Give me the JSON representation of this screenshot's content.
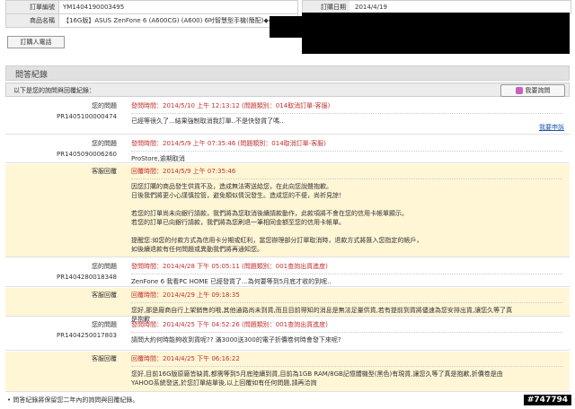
{
  "order": {
    "number_label": "訂單編號",
    "number": "YM1404190003495",
    "product_label": "商品名稱",
    "product": "【16G版】ASUS ZenFone 6 (A600CG) (A600) 6吋智慧型手機(簡配)◆4",
    "date_label": "訂購日期",
    "date": "2014/4/19",
    "phone_label": "訂購人電話"
  },
  "qa": {
    "title": "問答紀錄",
    "subtitle": "以下是您的詢問與回覆紀錄：",
    "ask_button": "我要詢問",
    "cancel_link": "我要申訴"
  },
  "messages": [
    {
      "role": "您的問題",
      "num": "PR1405100000474",
      "meta": "發問時間：2014/5/10 上午 12:13:12 (問題類別：014取消訂單-客服)",
      "body": [
        "已經等很久了...結果強制取消我訂單..不是快發貨了嗎.."
      ],
      "type": "user"
    },
    {
      "role": "您的問題",
      "num": "PR1405090006260",
      "meta": "發問時間：2014/5/9 上午 07:35:46 (問題類別：014取消訂單-客服)",
      "body": [
        "ProStore,逾期取消"
      ],
      "type": "user"
    },
    {
      "role": "客服回覆",
      "num": "",
      "meta": "回覆時間：2014/5/9 上午 07:35:46",
      "body": [
        "因您訂購的商品發生供貨不及，造成無法寄送給您，在此向您說聲抱歉。",
        "日後我們將更小心謹慎控管，避免類似情況發生。造成您的不便，尚祈見諒！",
        "",
        "若您的訂單尚未向銀行請款，我們將為您取消後續請款動作，此款項將不會在您的信用卡帳單顯示。",
        "若您的訂單已向銀行請款，我們將為您刷退一筆相同金額至您的信用卡帳單。",
        "",
        "提醒您:如您的付款方式為信用卡分期或紅利，當您辦理部分訂單取消時，退款方式將匯入您指定的帳戶，",
        "如後續退款有任何問題或異動我們將再通知您。"
      ],
      "type": "cs"
    },
    {
      "role": "您的問題",
      "num": "PR1404280018348",
      "meta": "發問時間：2014/4/28 下午 05:05:11 (問題類別：001查詢出貨進度)",
      "body": [
        "ZenFone 6 我看PC HOME 已經發貨了...為何要等到5月底才收的到呢.."
      ],
      "type": "user"
    },
    {
      "role": "客服回覆",
      "num": "",
      "meta": "回覆時間：2014/4/29 上午 09:18:35",
      "body": [
        "您好,那是廠商自行上架銷售的哦,其他通路尚未到貨,而且目前得知的消息是無法足量供貨,若有提前到貨將儘速為您安排出貨,讓您久等了真",
        "是抱歉"
      ],
      "type": "cs"
    },
    {
      "role": "您的問題",
      "num": "PR1404250017803",
      "meta": "發問時間：2014/4/25 下午 04:52:26 (問題類別：001查詢出貨進度)",
      "body": [
        "請問大約何時能夠收到貨呢?? 滿3000送300的電子折價卷何時會發下來呢?"
      ],
      "type": "user"
    },
    {
      "role": "客服回覆",
      "num": "",
      "meta": "回覆時間：2014/4/25 下午 06:16:22",
      "body": [
        "您好,目前16G版原廠皆缺貨,都需等到5月底陸續到貨,目前為1GB RAM/8GB記憶體機型(黑色)有現貨,讓您久等了真是抱歉,折價卷是由",
        "YAHOO系統發送,於您訂單結單後,以上回覆如有任何問題,請再洽詢"
      ],
      "type": "cs"
    }
  ],
  "footer": "•   問答紀錄將保留您二年內的詢問與回覆紀錄。",
  "watermark": "#747794"
}
